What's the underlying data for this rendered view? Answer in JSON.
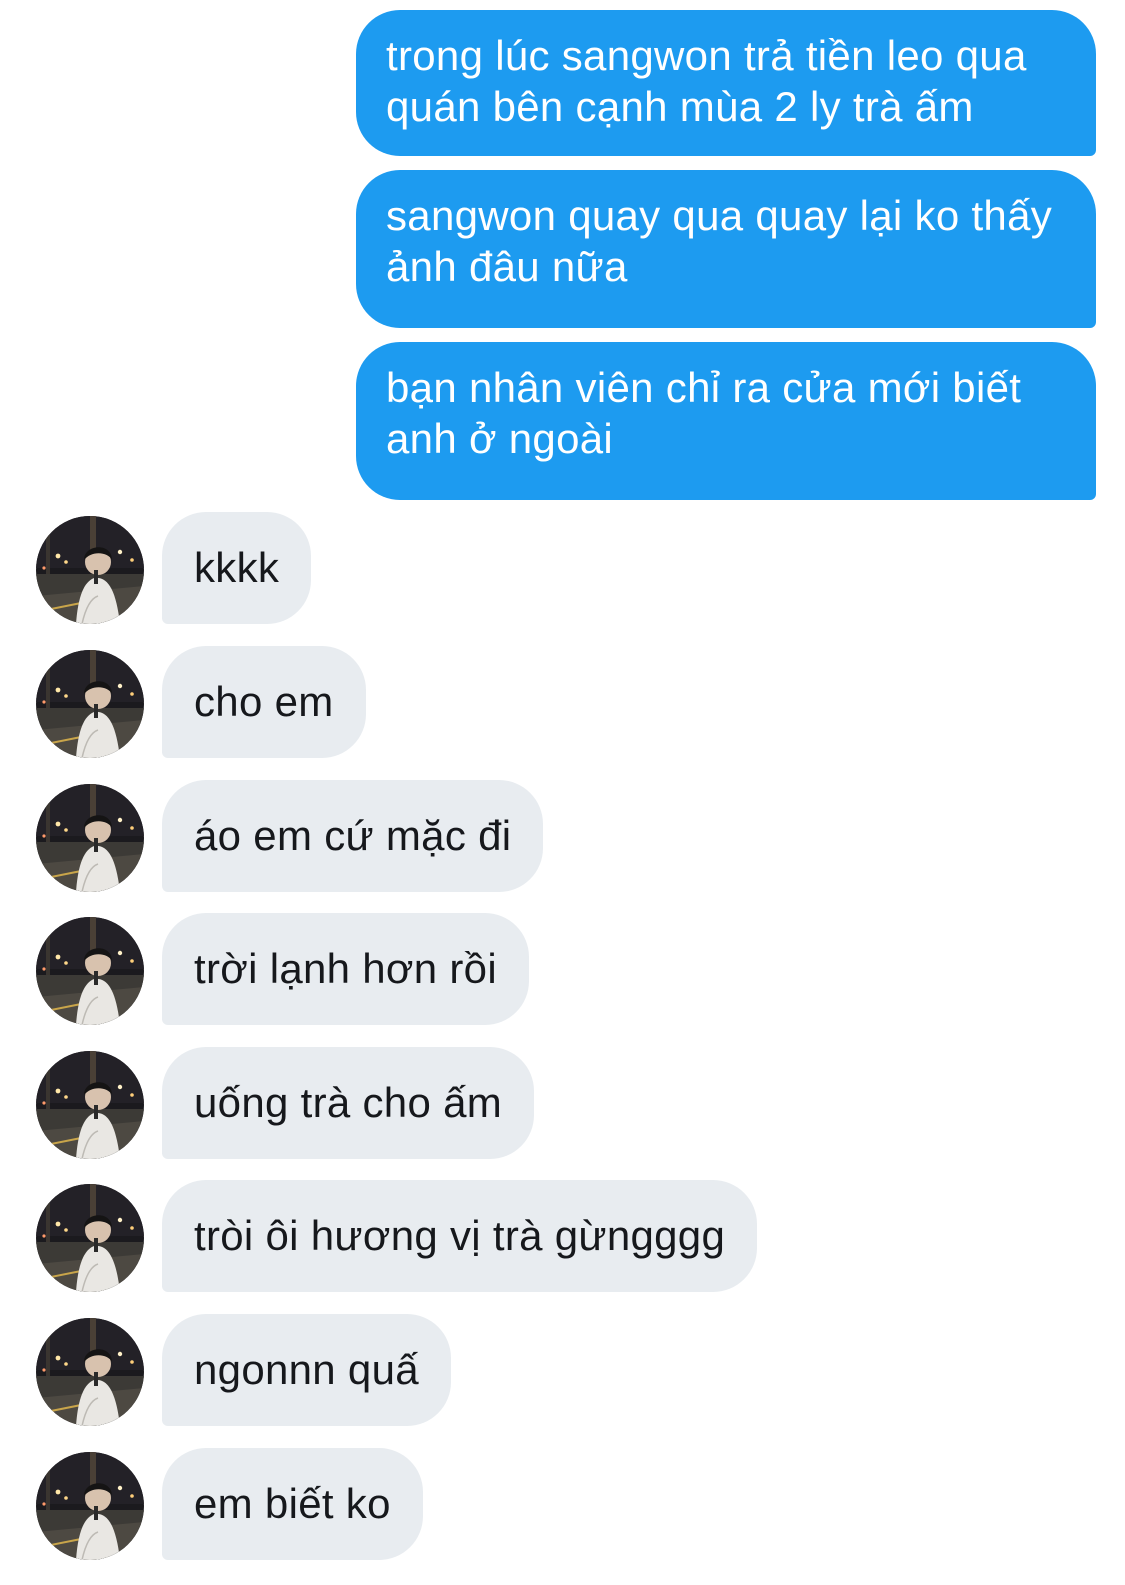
{
  "conversation": {
    "sent_messages": [
      "trong lúc sangwon trả tiền leo qua quán bên cạnh mùa 2 ly trà ấm",
      "sangwon quay qua quay lại ko thấy ảnh đâu nữa",
      "bạn nhân viên chỉ ra cửa mới biết anh ở ngoài"
    ],
    "received_messages": [
      "kkkk",
      "cho em",
      "áo em cứ mặc đi",
      "trời lạnh hơn rồi",
      "uống trà cho ấm",
      "tròi ôi hương vị trà gừngggg",
      "ngonnn quấ",
      "em biết ko"
    ]
  },
  "colors": {
    "sent_bubble": "#1d9bf0",
    "received_bubble": "#e8ecf0"
  },
  "icons": {
    "avatar": "profile-photo-avatar"
  }
}
